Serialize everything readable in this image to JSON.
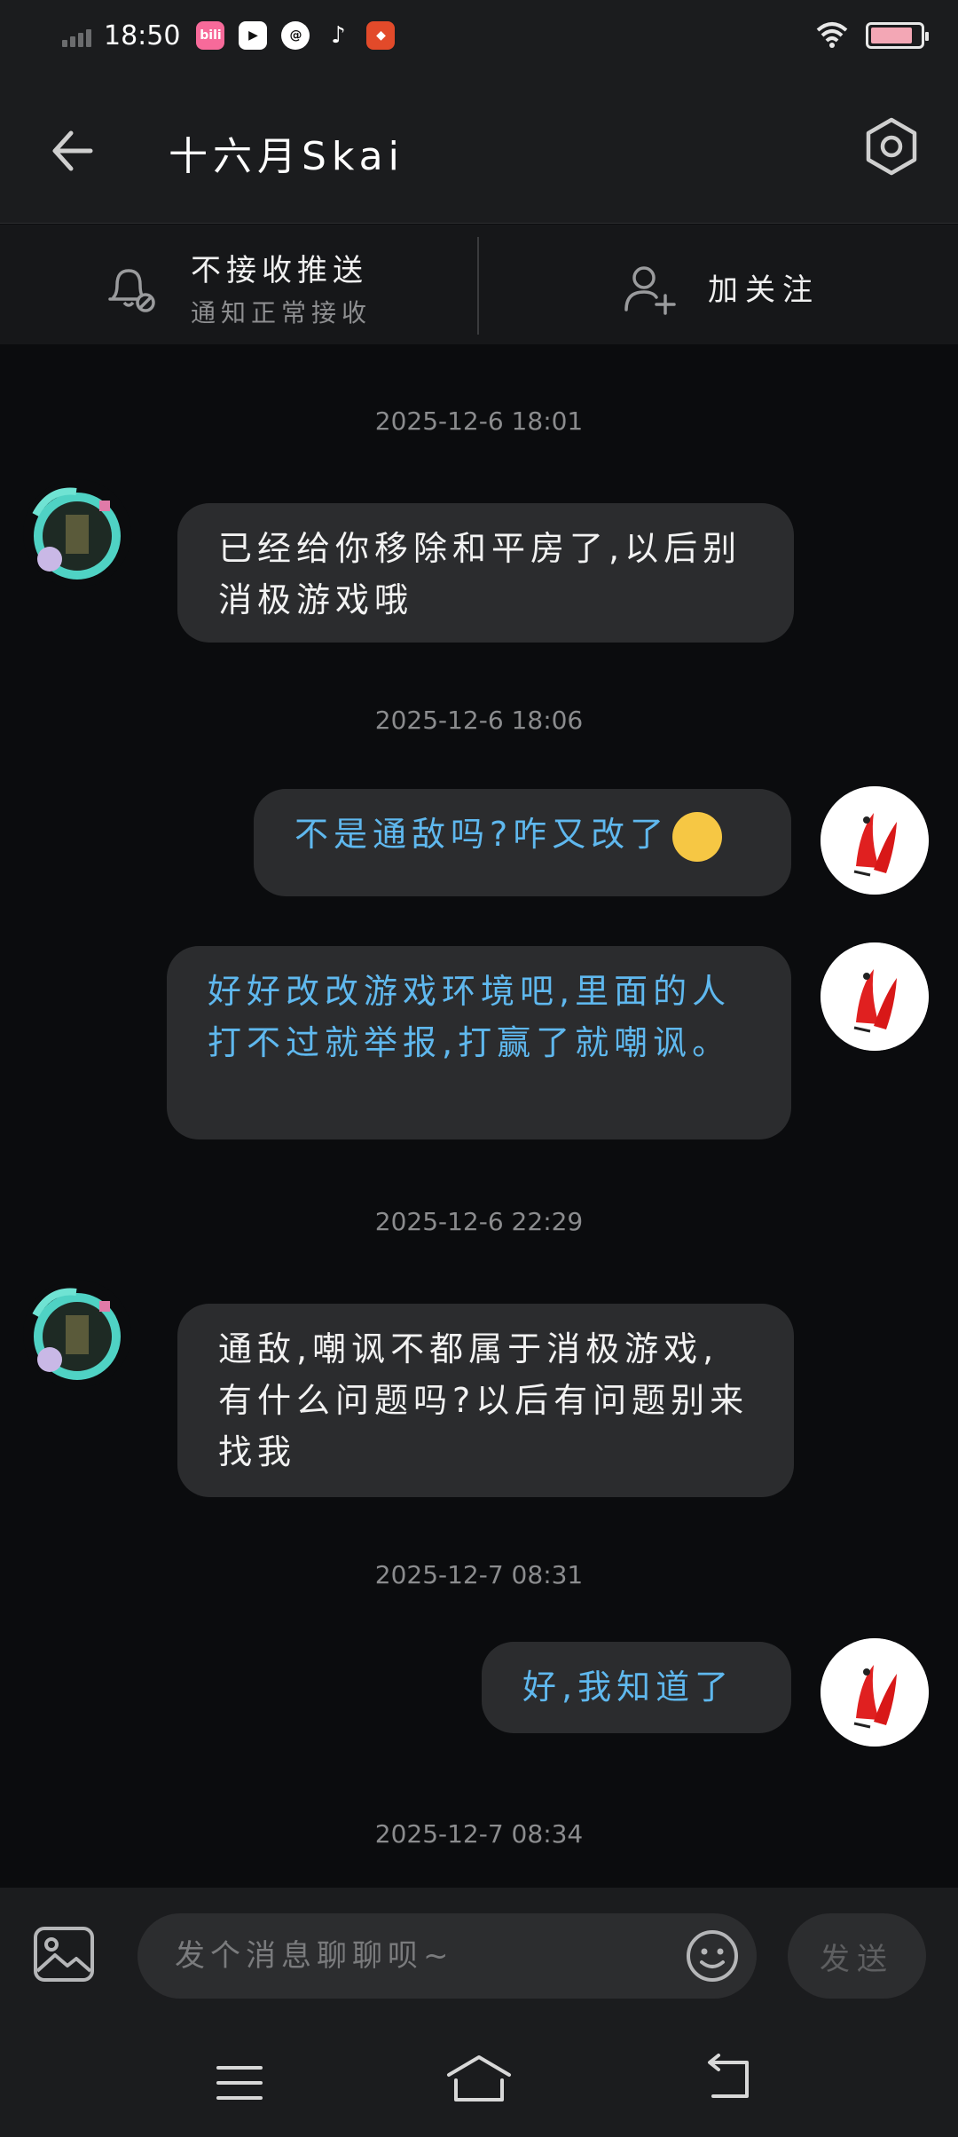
{
  "status_bar": {
    "time": "18:50",
    "apps": [
      {
        "name": "bilibili-icon",
        "label": "bili",
        "color": "#f76a9a"
      },
      {
        "name": "video-icon",
        "label": "▶",
        "color": "#222222"
      },
      {
        "name": "search-app-icon",
        "label": "@",
        "color": "#222222"
      },
      {
        "name": "tiktok-icon",
        "label": "♪",
        "color": "#222222"
      },
      {
        "name": "game-app-icon",
        "label": "◆",
        "color": "#e24a2a"
      }
    ],
    "battery_level": 0.85
  },
  "header": {
    "title": "十六月Skai"
  },
  "actions": {
    "push_title": "不接收推送",
    "push_subtitle": "通知正常接收",
    "follow_label": "加关注"
  },
  "messages": [
    {
      "type": "timestamp",
      "text": "2025-12-6 18:01"
    },
    {
      "type": "in",
      "text": "已经给你移除和平房了,以后别消极游戏哦"
    },
    {
      "type": "timestamp",
      "text": "2025-12-6 18:06"
    },
    {
      "type": "out",
      "text": "不是通敌吗?咋又改了"
    },
    {
      "type": "out",
      "text": "好好改改游戏环境吧,里面的人打不过就举报,打赢了就嘲讽。"
    },
    {
      "type": "timestamp",
      "text": "2025-12-6 22:29"
    },
    {
      "type": "in",
      "text": "通敌,嘲讽不都属于消极游戏,有什么问题吗?以后有问题别来找我"
    },
    {
      "type": "timestamp",
      "text": "2025-12-7 08:31"
    },
    {
      "type": "out",
      "text": "好,我知道了"
    },
    {
      "type": "timestamp",
      "text": "2025-12-7 08:34"
    }
  ],
  "composer": {
    "placeholder": "发个消息聊聊呗~",
    "send_label": "发送"
  },
  "colors": {
    "background": "#0b0c0e",
    "bar": "#1b1c1e",
    "bubble": "#2b2c2e",
    "outgoing_text": "#5fb8ee",
    "incoming_text": "#f2f2f2"
  }
}
